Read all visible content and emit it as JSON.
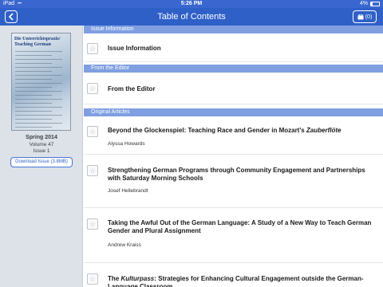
{
  "status_bar": {
    "device": "iPad",
    "time": "5:26 PM",
    "battery": "4%"
  },
  "nav": {
    "title": "Table of Contents",
    "cart_count": "(0)"
  },
  "sidebar": {
    "cover_title": "Die Unterrichtspraxis/ Teaching German",
    "season": "Spring 2014",
    "volume": "Volume 47",
    "issue": "Issue 1",
    "download_label": "Download Issue (3.8MB)"
  },
  "sections": {
    "issue_info": {
      "header": "Issue Information",
      "item": "Issue Information"
    },
    "editor": {
      "header": "From the Editor",
      "item": "From the Editor"
    },
    "articles": {
      "header": "Original Articles",
      "items": [
        {
          "title_a": "Beyond the Glockenspiel: Teaching Race and Gender in Mozart's ",
          "title_em": "Zauberflöte",
          "author": "Alyssa Howards"
        },
        {
          "title": "Strengthening German Programs through Community Engagement and Partnerships with Saturday Morning Schools",
          "author": "Josef Hellebrandt"
        },
        {
          "title": "Taking the Awful Out of the German Language: A Study of a New Way to Teach German Gender and Plural Assignment",
          "author": "Andrew Kraiss"
        },
        {
          "title_a": "The ",
          "title_em": "Kulturpass",
          "title_b": ": Strategies for Enhancing Cultural Engagement outside the German-Language Classroom"
        }
      ]
    }
  }
}
